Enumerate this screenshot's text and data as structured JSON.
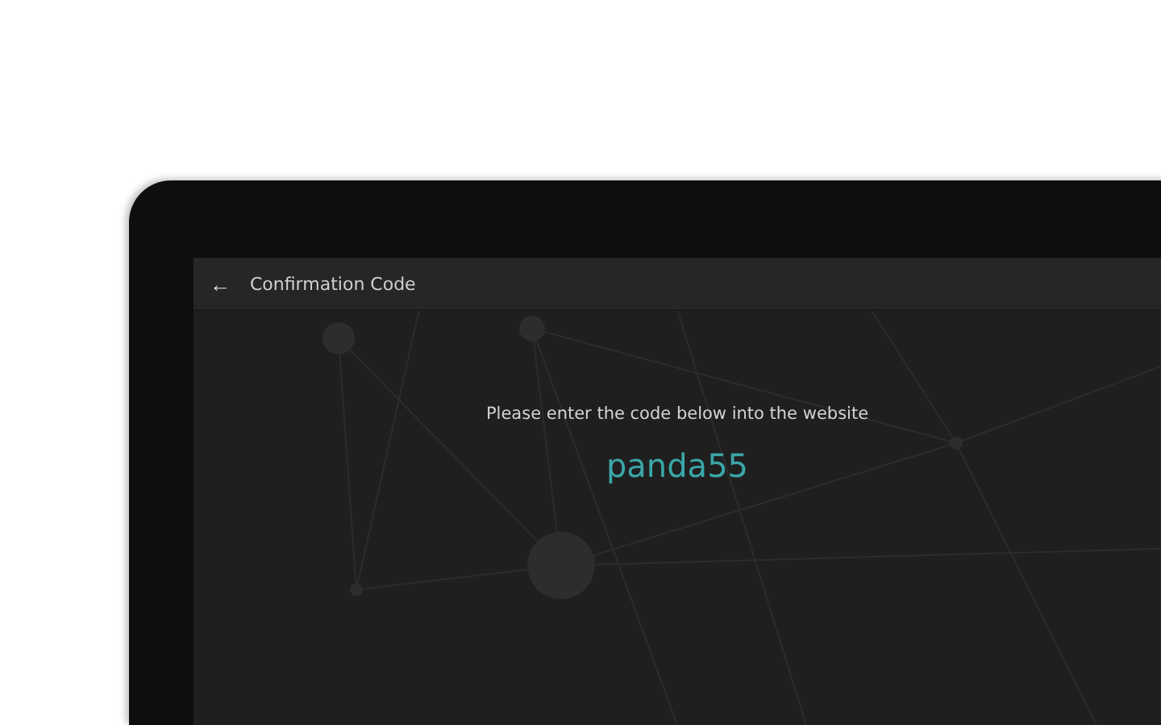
{
  "header": {
    "back_icon": "←",
    "title": "Confirmation Code"
  },
  "prompt": "Please enter the code below into the website",
  "code": "panda55"
}
